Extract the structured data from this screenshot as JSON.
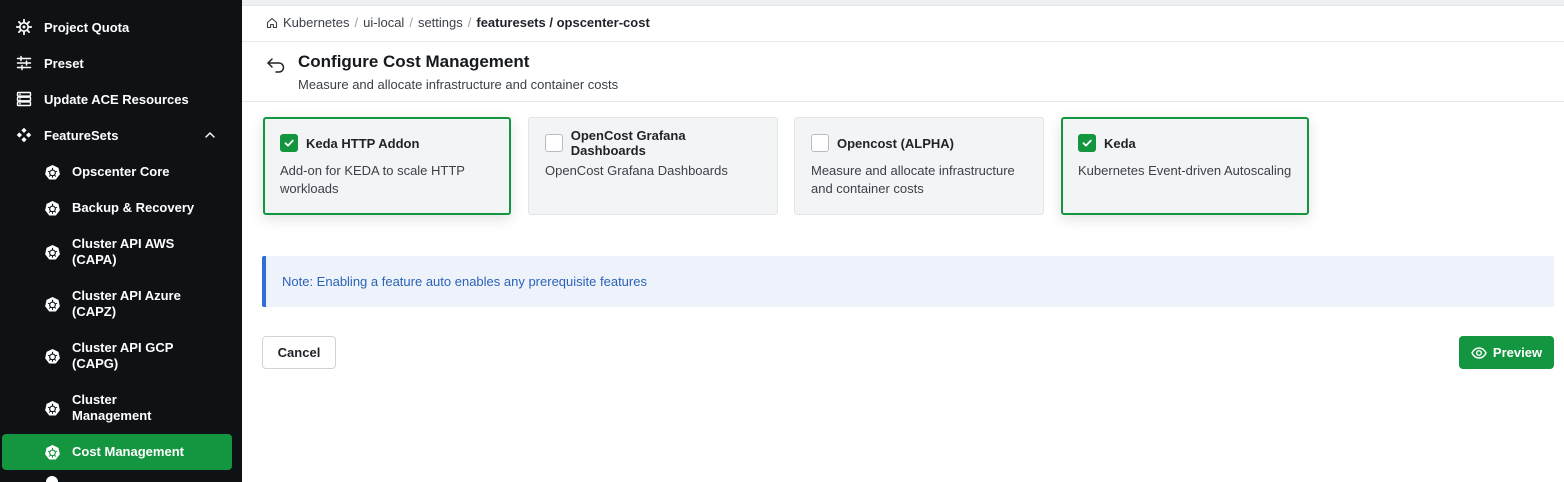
{
  "sidebar": {
    "top_items": [
      {
        "label": "Project Quota",
        "icon": "gear-icon"
      },
      {
        "label": "Preset",
        "icon": "sliders-icon"
      },
      {
        "label": "Update ACE Resources",
        "icon": "server-icon"
      },
      {
        "label": "FeatureSets",
        "icon": "diamond-grid-icon",
        "expanded": true
      }
    ],
    "sub_items": [
      {
        "label": "Opscenter Core",
        "icon": "kubernetes-icon"
      },
      {
        "label": "Backup & Recovery",
        "icon": "kubernetes-icon"
      },
      {
        "label": "Cluster API AWS (CAPA)",
        "icon": "kubernetes-icon"
      },
      {
        "label": "Cluster API Azure (CAPZ)",
        "icon": "kubernetes-icon"
      },
      {
        "label": "Cluster API GCP (CAPG)",
        "icon": "kubernetes-icon"
      },
      {
        "label": "Cluster Management",
        "icon": "kubernetes-icon"
      },
      {
        "label": "Cost Management",
        "icon": "kubernetes-icon",
        "active": true
      }
    ],
    "active_color": "#14953f"
  },
  "breadcrumb": {
    "items": [
      "Kubernetes",
      "ui-local",
      "settings"
    ],
    "current": "featuresets / opscenter-cost",
    "separator": "/"
  },
  "page": {
    "title": "Configure Cost Management",
    "subtitle": "Measure and allocate infrastructure and container costs"
  },
  "features": [
    {
      "title": "Keda HTTP Addon",
      "description": "Add-on for KEDA to scale HTTP workloads",
      "checked": true
    },
    {
      "title": "OpenCost Grafana Dashboards",
      "description": "OpenCost Grafana Dashboards",
      "checked": false
    },
    {
      "title": "Opencost (ALPHA)",
      "description": "Measure and allocate infrastructure and container costs",
      "checked": false
    },
    {
      "title": "Keda",
      "description": "Kubernetes Event-driven Autoscaling",
      "checked": true
    }
  ],
  "note": "Note: Enabling a feature auto enables any prerequisite features",
  "actions": {
    "cancel": "Cancel",
    "preview": "Preview"
  },
  "colors": {
    "primary": "#14953f",
    "sidebar_bg": "#0f1214",
    "note_accent": "#2f6fd6"
  }
}
